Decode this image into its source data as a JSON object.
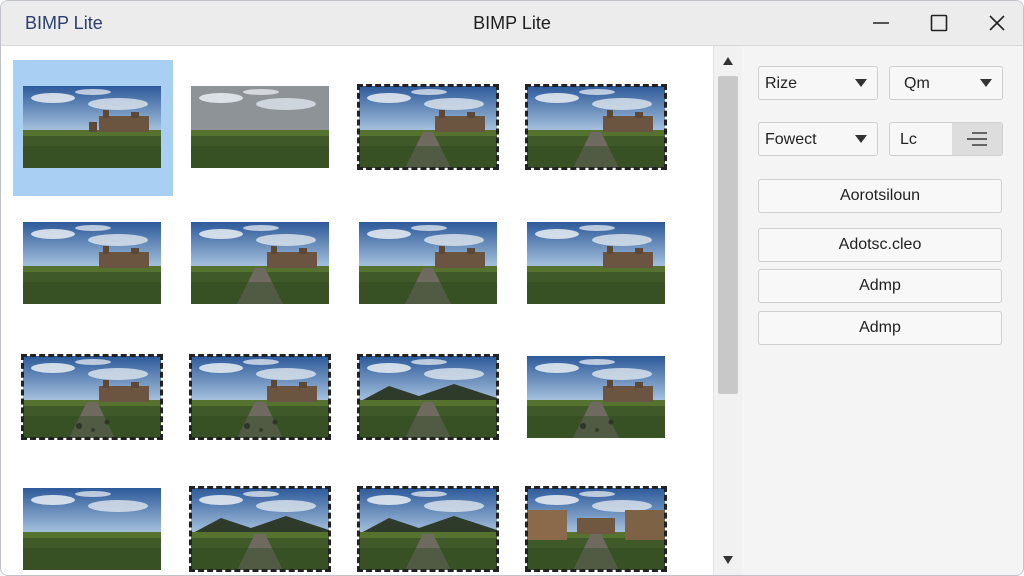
{
  "window": {
    "app_name": "BIMP Lite",
    "title": "BIMP Lite"
  },
  "panel": {
    "dropdown_size": "Rize",
    "dropdown_format": "Qm",
    "dropdown_preset": "Fowect",
    "field_text": "Lc",
    "buttons": [
      "Aorotsiloun",
      "Adotsc.cleo",
      "Admp",
      "Admp"
    ]
  },
  "thumbnails": [
    {
      "scene": "field-ruin",
      "selected": true,
      "torn": false
    },
    {
      "scene": "field-clouds",
      "selected": false,
      "torn": false
    },
    {
      "scene": "road-castle",
      "selected": false,
      "torn": true
    },
    {
      "scene": "road-ruin",
      "selected": false,
      "torn": true
    },
    {
      "scene": "ruin-sky",
      "selected": false,
      "torn": false
    },
    {
      "scene": "road-castle",
      "selected": false,
      "torn": false
    },
    {
      "scene": "road-castle",
      "selected": false,
      "torn": false
    },
    {
      "scene": "ruin-sky",
      "selected": false,
      "torn": false
    },
    {
      "scene": "castle-rubble",
      "selected": false,
      "torn": true
    },
    {
      "scene": "ruin-rubble",
      "selected": false,
      "torn": true
    },
    {
      "scene": "hills-road",
      "selected": false,
      "torn": true
    },
    {
      "scene": "ruin-rubble",
      "selected": false,
      "torn": false
    },
    {
      "scene": "field-sky",
      "selected": false,
      "torn": false
    },
    {
      "scene": "hills-road",
      "selected": false,
      "torn": true
    },
    {
      "scene": "hills-road",
      "selected": false,
      "torn": true
    },
    {
      "scene": "courtyard",
      "selected": false,
      "torn": true
    }
  ],
  "colors": {
    "selection": "#a9cff2",
    "titlebar": "#ececec",
    "app_name": "#2a3f6b"
  }
}
